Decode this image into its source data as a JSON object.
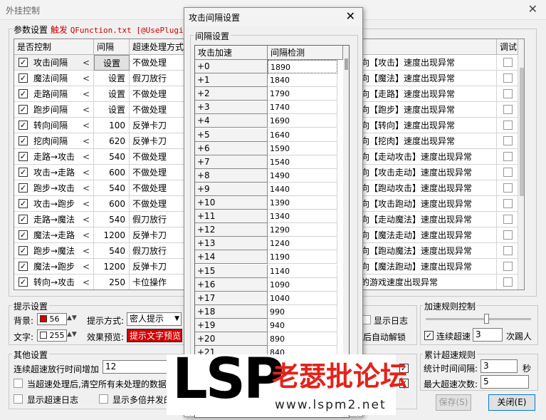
{
  "window": {
    "title": "外挂控制",
    "close_glyph": "✕"
  },
  "params": {
    "legend_prefix": "参数设置",
    "legend_highlight": "触发",
    "legend_rest": "QFunction.txt [@UsePlugin]",
    "headers": [
      "是否控制",
      "间隔",
      "超速处理方式",
      "调试"
    ],
    "rows": [
      {
        "name": "攻击间隔",
        "interval": "设置",
        "mode": "不做处理",
        "msg": "向【攻击】速度出现异常"
      },
      {
        "name": "魔法间隔",
        "interval": "设置",
        "mode": "假刀放行",
        "msg": "向【魔法】速度出现异常"
      },
      {
        "name": "走路间隔",
        "interval": "设置",
        "mode": "不做处理",
        "msg": "向【走路】速度出现异常"
      },
      {
        "name": "跑步间隔",
        "interval": "设置",
        "mode": "不做处理",
        "msg": "向【跑步】速度出现异常"
      },
      {
        "name": "转向间隔",
        "interval": "100",
        "mode": "反弹卡刀",
        "msg": "向【转向】速度出现异常"
      },
      {
        "name": "挖肉间隔",
        "interval": "620",
        "mode": "反弹卡刀",
        "msg": "向【挖肉】速度出现异常"
      },
      {
        "name": "走路→攻击",
        "interval": "540",
        "mode": "不做处理",
        "msg": "向【走动攻击】速度出现异常"
      },
      {
        "name": "攻击→走路",
        "interval": "600",
        "mode": "不做处理",
        "msg": "向【攻击走动】速度出现异常"
      },
      {
        "name": "跑步→攻击",
        "interval": "540",
        "mode": "不做处理",
        "msg": "向【跑动攻击】速度出现异常"
      },
      {
        "name": "攻击→跑步",
        "interval": "600",
        "mode": "不做处理",
        "msg": "向【攻击跑动】速度出现异常"
      },
      {
        "name": "走路→魔法",
        "interval": "540",
        "mode": "假刀放行",
        "msg": "向【走动魔法】速度出现异常"
      },
      {
        "name": "魔法→走路",
        "interval": "1200",
        "mode": "反弹卡刀",
        "msg": "向【魔法走动】速度出现异常"
      },
      {
        "name": "跑步→魔法",
        "interval": "540",
        "mode": "假刀放行",
        "msg": "向【跑动魔法】速度出现异常"
      },
      {
        "name": "魔法→跑步",
        "interval": "1200",
        "mode": "反弹卡刀",
        "msg": "向【魔法跑动】速度出现异常"
      },
      {
        "name": "转向→攻击",
        "interval": "250",
        "mode": "卡位操作",
        "msg": "的游戏速度出现异常"
      }
    ]
  },
  "hint": {
    "legend": "提示设置",
    "bg_label": "背景:",
    "bg_value": "56",
    "text_label": "文字:",
    "text_value": "255",
    "method_label": "提示方式:",
    "method_value": "密人提示",
    "preview_label": "效果预览:",
    "preview_text": "提示文字预览",
    "show_log": "显示日志",
    "auto_unlock": "后自动解锁"
  },
  "other": {
    "legend": "其他设置",
    "increase_label": "连续超速放行时间增加",
    "increase_value": "12",
    "clear_label": "当超速处理后,清空所有未处理的数据",
    "show_log_label": "显示超速日志",
    "multi_label": "显示多倍并发的"
  },
  "rule": {
    "legend": "加速规则控制",
    "consecutive_label": "连续超速",
    "consecutive_value": "3",
    "kick_label": "次踢人"
  },
  "cumul": {
    "legend": "累计超速规则",
    "interval_label": "统计时间间隔:",
    "interval_value": "3",
    "sec": "秒",
    "max_label": "最大超速次数:",
    "max_value": "5"
  },
  "buttons": {
    "save": "保存(S)",
    "close": "关闭(E)"
  },
  "dialog": {
    "title": "攻击间隔设置",
    "group": "间隔设置",
    "headers": [
      "攻击加速",
      "间隔检测"
    ],
    "rows": [
      [
        "+0",
        "1890"
      ],
      [
        "+1",
        "1840"
      ],
      [
        "+2",
        "1790"
      ],
      [
        "+3",
        "1740"
      ],
      [
        "+4",
        "1690"
      ],
      [
        "+5",
        "1640"
      ],
      [
        "+6",
        "1590"
      ],
      [
        "+7",
        "1540"
      ],
      [
        "+8",
        "1490"
      ],
      [
        "+9",
        "1440"
      ],
      [
        "+10",
        "1390"
      ],
      [
        "+11",
        "1340"
      ],
      [
        "+12",
        "1290"
      ],
      [
        "+13",
        "1240"
      ],
      [
        "+14",
        "1190"
      ],
      [
        "+15",
        "1140"
      ],
      [
        "+16",
        "1090"
      ],
      [
        "+17",
        "1040"
      ],
      [
        "+18",
        "990"
      ],
      [
        "+19",
        "940"
      ],
      [
        "+20",
        "890"
      ],
      [
        "+21",
        "840"
      ]
    ]
  },
  "watermark": {
    "logo": "LSP",
    "cn": "老瑟批论坛",
    "url": "www.lspm2.net"
  }
}
